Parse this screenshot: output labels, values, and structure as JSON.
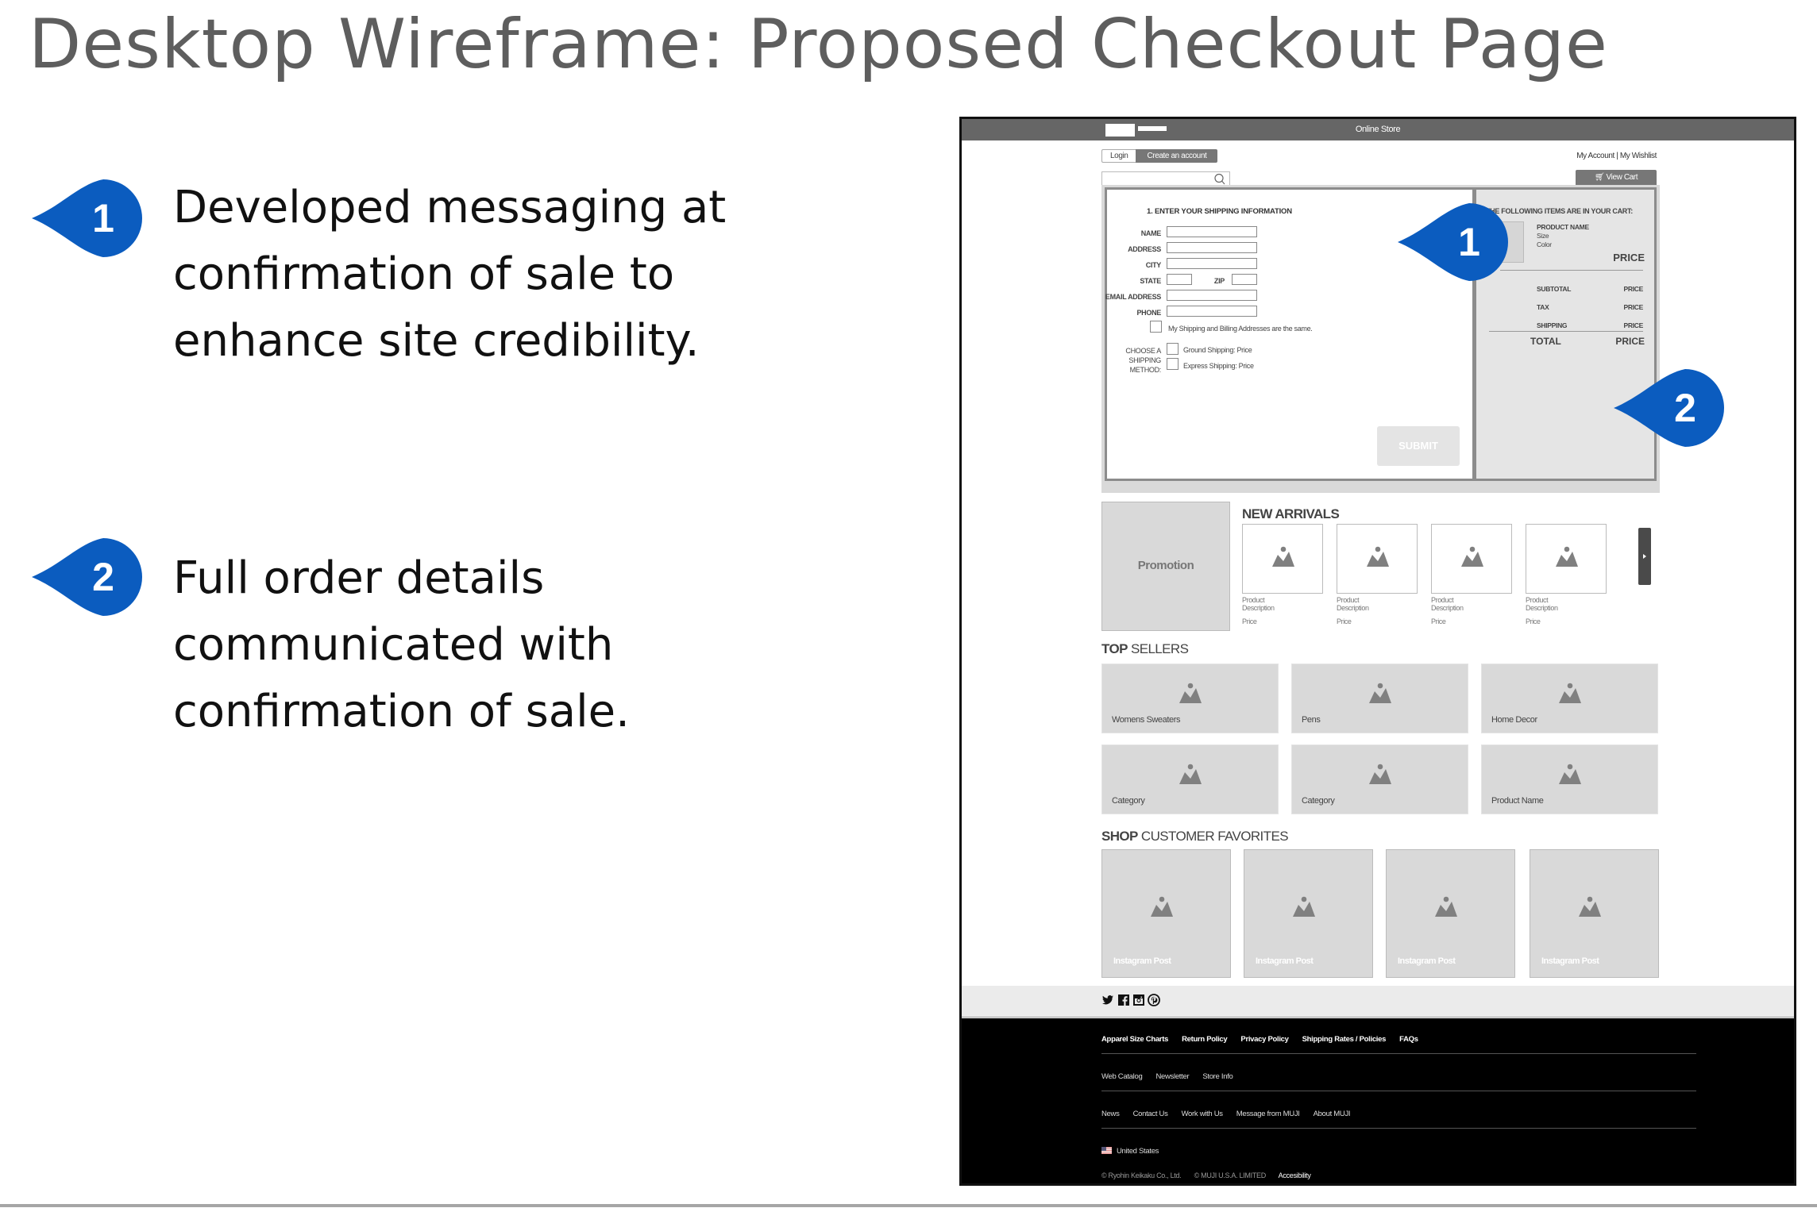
{
  "slide": {
    "title": "Desktop Wireframe: Proposed Checkout Page",
    "accent_color": "#0b5cbf",
    "callouts": [
      {
        "number": "1",
        "lines": [
          "Developed messaging at",
          "confirmation of sale to",
          "enhance site credibility."
        ]
      },
      {
        "number": "2",
        "lines": [
          "Full order details",
          "communicated with",
          "confirmation of sale."
        ]
      }
    ]
  },
  "wireframe": {
    "header": {
      "store_title": "Online Store"
    },
    "auth": {
      "login": "Login",
      "create_account": "Create an account"
    },
    "account_links": "My Account | My Wishlist",
    "search": {
      "placeholder": "",
      "icon": "search-icon"
    },
    "view_cart": {
      "label": "View Cart",
      "icon": "cart-icon"
    },
    "markers": [
      {
        "number": "1"
      },
      {
        "number": "2"
      }
    ],
    "checkout": {
      "heading": "1.  ENTER YOUR SHIPPING INFORMATION",
      "fields": {
        "name": "NAME",
        "address": "ADDRESS",
        "city": "CITY",
        "state": "STATE",
        "zip": "ZIP",
        "email": "EMAIL ADDRESS",
        "phone": "PHONE"
      },
      "same_address": "My Shipping and Billing Addresses are the same.",
      "shipping_method_label": [
        "CHOOSE A",
        "SHIPPING",
        "METHOD:"
      ],
      "shipping_options": [
        "Ground Shipping: Price",
        "Express Shipping: Price"
      ],
      "submit": "SUBMIT"
    },
    "cart": {
      "heading": "THE FOLLOWING ITEMS ARE IN YOUR CART:",
      "product_name": "PRODUCT NAME",
      "size": "Size",
      "color": "Color",
      "item_price": "PRICE",
      "rows": [
        {
          "label": "SUBTOTAL",
          "value": "PRICE"
        },
        {
          "label": "TAX",
          "value": "PRICE"
        },
        {
          "label": "SHIPPING",
          "value": "PRICE"
        }
      ],
      "total_label": "TOTAL",
      "total_value": "PRICE"
    },
    "promotion": "Promotion",
    "new_arrivals": {
      "title_bold": "NEW ARRIVALS",
      "items": [
        {
          "desc1": "Product",
          "desc2": "Description",
          "price": "Price"
        },
        {
          "desc1": "Product",
          "desc2": "Description",
          "price": "Price"
        },
        {
          "desc1": "Product",
          "desc2": "Description",
          "price": "Price"
        },
        {
          "desc1": "Product",
          "desc2": "Description",
          "price": "Price"
        }
      ]
    },
    "top_sellers": {
      "title_bold": "TOP",
      "title_rest": " SELLERS",
      "items": [
        "Womens Sweaters",
        "Pens",
        "Home Decor",
        "Category",
        "Category",
        "Product Name"
      ]
    },
    "favorites": {
      "title_bold": "SHOP",
      "title_rest": " CUSTOMER FAVORITES",
      "items": [
        "Instagram Post",
        "Instagram Post",
        "Instagram Post",
        "Instagram Post"
      ]
    },
    "social": [
      "twitter-icon",
      "facebook-icon",
      "instagram-icon",
      "pinterest-icon"
    ],
    "footer": {
      "row1": [
        "Apparel Size Charts",
        "Return Policy",
        "Privacy Policy",
        "Shipping Rates / Policies",
        "FAQs"
      ],
      "row2": [
        "Web Catalog",
        "Newsletter",
        "Store Info"
      ],
      "row3": [
        "News",
        "Contact Us",
        "Work with Us",
        "Message from MUJI",
        "About MUJI"
      ],
      "country": "United States",
      "copyright1": "© Ryohin Keikaku Co., Ltd.",
      "copyright2": "© MUJI U.S.A. LIMITED",
      "accessibility": "Accesibility"
    }
  }
}
